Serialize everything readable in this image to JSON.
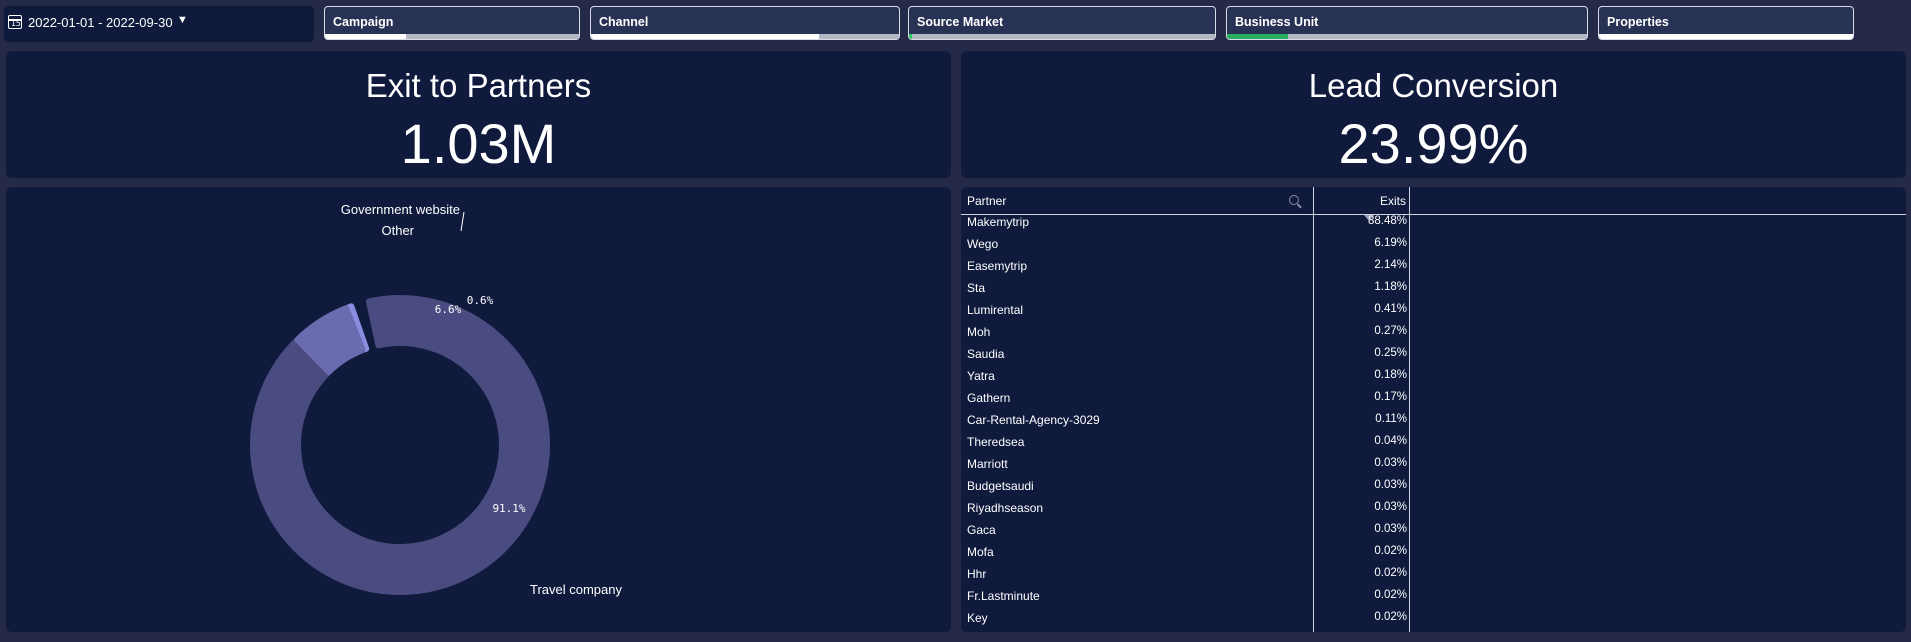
{
  "filters": {
    "date_range": "2022-01-01 - 2022-09-30",
    "items": [
      {
        "label": "Campaign",
        "fill": 0.32
      },
      {
        "label": "Channel",
        "fill": 0.74
      },
      {
        "label": "Source Market",
        "fill": 0.01,
        "accent": "#2ecc71"
      },
      {
        "label": "Business Unit",
        "fill": 0.17,
        "accent": "#27ae60"
      },
      {
        "label": "Properties",
        "fill": 1.0
      }
    ]
  },
  "kpis": {
    "exit_title": "Exit to Partners",
    "exit_value": "1.03M",
    "lead_title": "Lead Conversion",
    "lead_value": "23.99%"
  },
  "chart_data": {
    "type": "pie",
    "title": "",
    "slices": [
      {
        "label": "Travel company",
        "value": 91.1,
        "pct_label": "91.1%",
        "color": "#4a4b80"
      },
      {
        "label": "Other",
        "value": 6.6,
        "pct_label": "6.6%",
        "color": "#6b6cb0"
      },
      {
        "label": "Government website",
        "value": 0.6,
        "pct_label": "0.6%",
        "color": "#8a8ce0"
      },
      {
        "label": "",
        "value": 1.7,
        "pct_label": "",
        "color": "#0f1a3c"
      }
    ]
  },
  "table": {
    "col_partner": "Partner",
    "col_exits": "Exits",
    "rows": [
      {
        "partner": "Makemytrip",
        "exits": "88.48%"
      },
      {
        "partner": "Wego",
        "exits": "6.19%"
      },
      {
        "partner": "Easemytrip",
        "exits": "2.14%"
      },
      {
        "partner": "Sta",
        "exits": "1.18%"
      },
      {
        "partner": "Lumirental",
        "exits": "0.41%"
      },
      {
        "partner": "Moh",
        "exits": "0.27%"
      },
      {
        "partner": "Saudia",
        "exits": "0.25%"
      },
      {
        "partner": "Yatra",
        "exits": "0.18%"
      },
      {
        "partner": "Gathern",
        "exits": "0.17%"
      },
      {
        "partner": "Car-Rental-Agency-3029",
        "exits": "0.11%"
      },
      {
        "partner": "Theredsea",
        "exits": "0.04%"
      },
      {
        "partner": "Marriott",
        "exits": "0.03%"
      },
      {
        "partner": "Budgetsaudi",
        "exits": "0.03%"
      },
      {
        "partner": "Riyadhseason",
        "exits": "0.03%"
      },
      {
        "partner": "Gaca",
        "exits": "0.03%"
      },
      {
        "partner": "Mofa",
        "exits": "0.02%"
      },
      {
        "partner": "Hhr",
        "exits": "0.02%"
      },
      {
        "partner": "Fr.Lastminute",
        "exits": "0.02%"
      },
      {
        "partner": "Key",
        "exits": "0.02%"
      }
    ]
  },
  "colors": {
    "background": "#252a48",
    "panel": "#0f1a3c"
  }
}
